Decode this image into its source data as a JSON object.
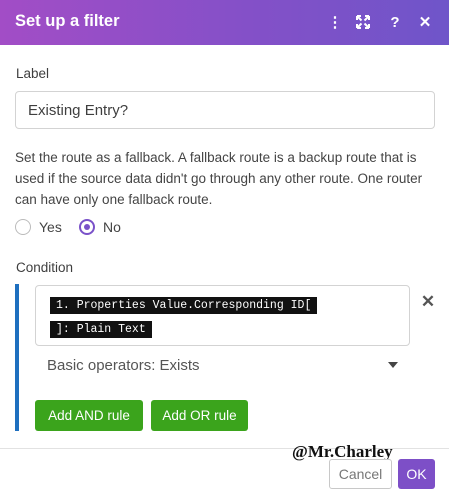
{
  "header": {
    "title": "Set up a filter",
    "icons": [
      "more-vertical-icon",
      "expand-icon",
      "help-icon",
      "close-icon"
    ],
    "more_glyph": "⋮",
    "help_glyph": "?",
    "close_glyph": "✕"
  },
  "label": {
    "title": "Label",
    "value": "Existing Entry?"
  },
  "fallback": {
    "description": "Set the route as a fallback. A fallback route is a backup route that is used if the source data didn't go through any other route. One router can have only one fallback route.",
    "options": [
      {
        "label": "Yes",
        "checked": false
      },
      {
        "label": "No",
        "checked": true
      }
    ]
  },
  "condition": {
    "title": "Condition",
    "pill_line1": "1. Properties Value.Corresponding ID[",
    "pill_line2": "]: Plain Text",
    "operator": "Basic operators: Exists",
    "remove_glyph": "✕",
    "add_and_label": "Add AND rule",
    "add_or_label": "Add OR rule"
  },
  "watermark": "@Mr.Charley",
  "footer": {
    "cancel_label": "Cancel",
    "ok_label": "OK"
  },
  "colors": {
    "header_gradient_start": "#a24dc6",
    "header_gradient_end": "#6f55c9",
    "accent_purple": "#7d4fc7",
    "condition_bar": "#1e6fbf",
    "green_button": "#3ba41c"
  }
}
